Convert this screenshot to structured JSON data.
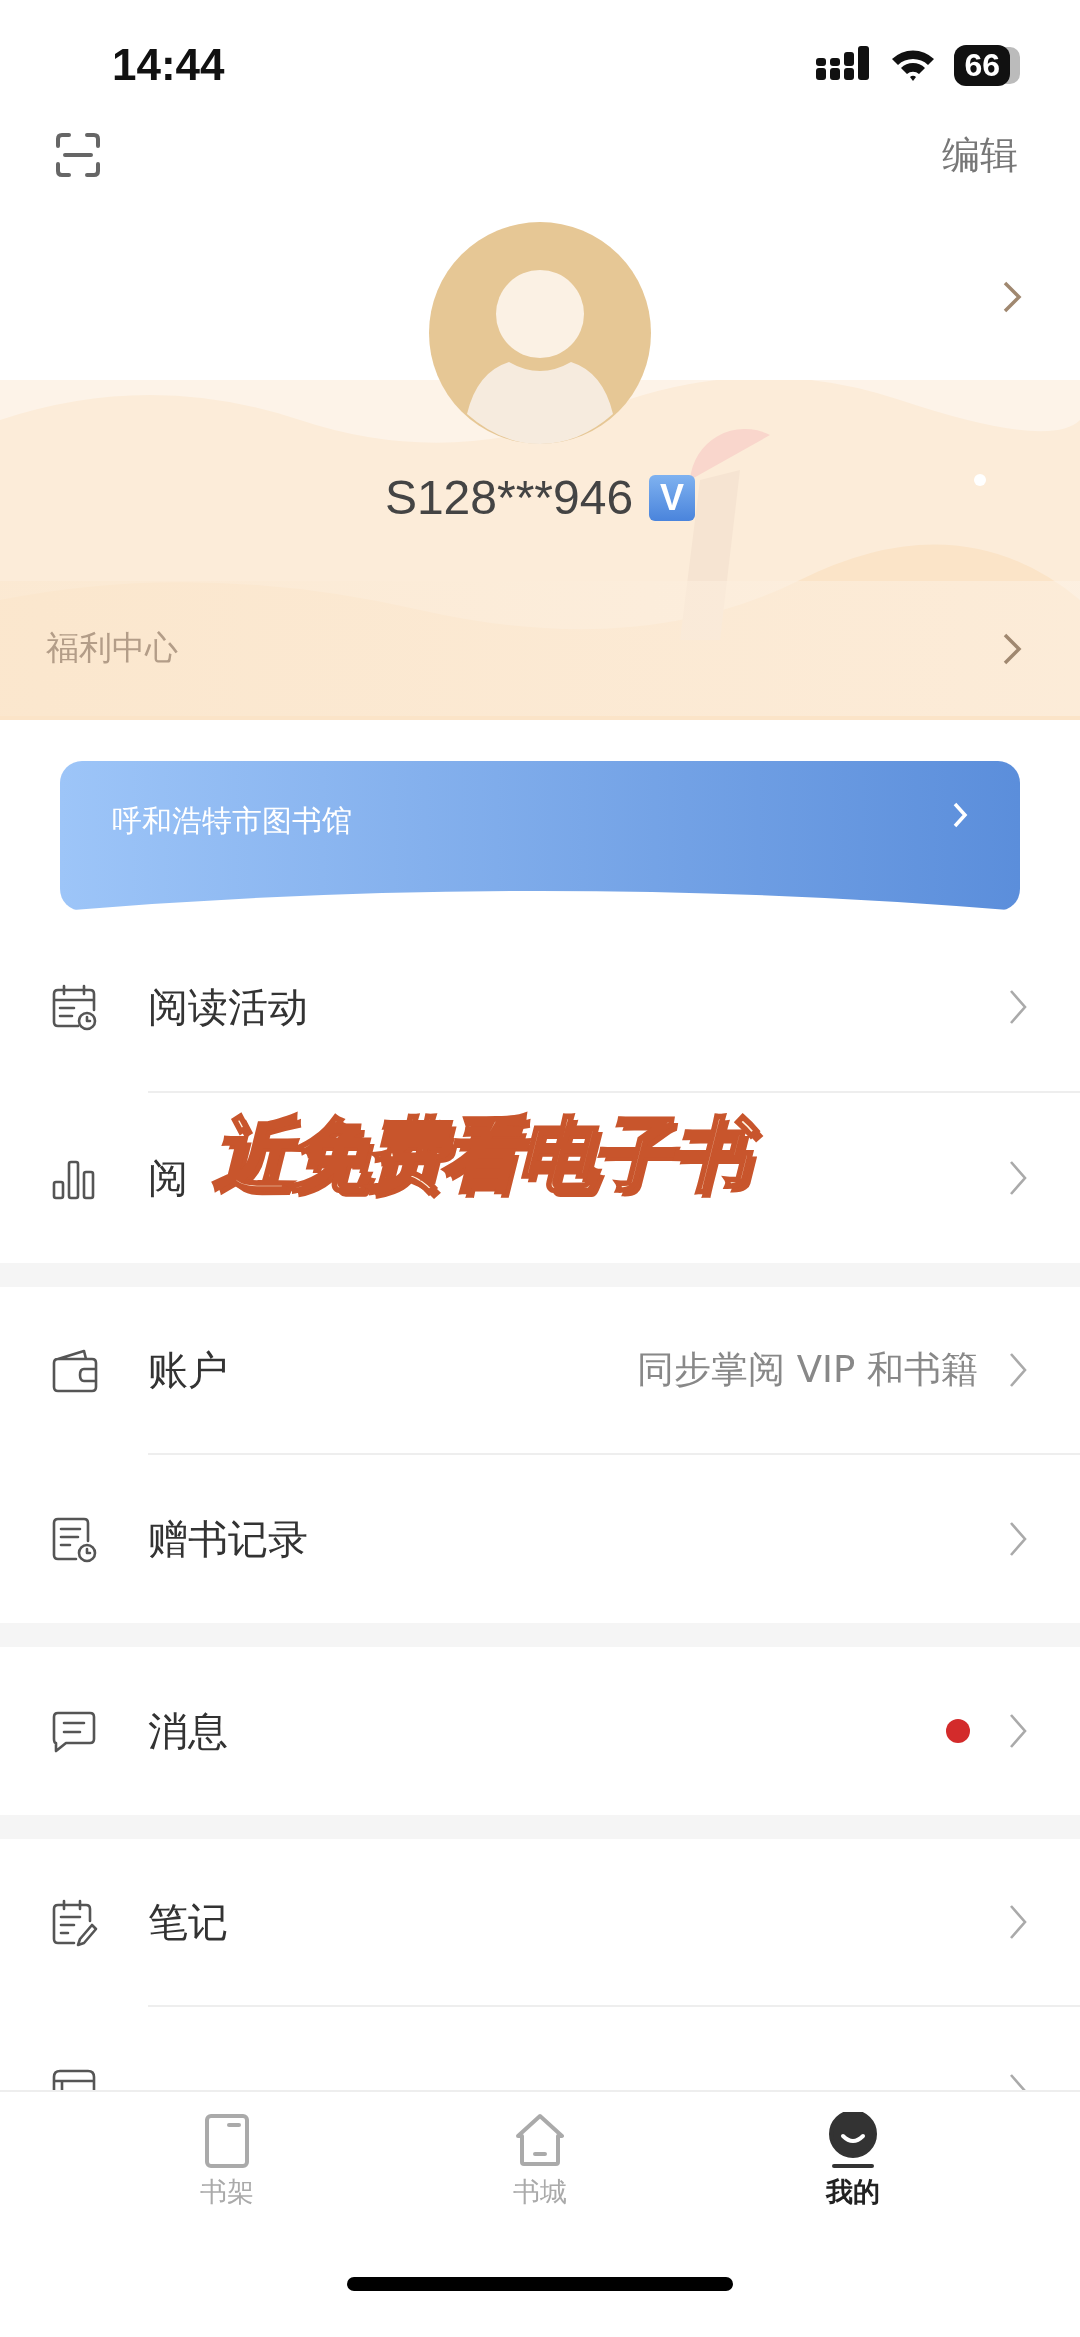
{
  "status_bar": {
    "time": "14:44",
    "battery": "66"
  },
  "top_bar": {
    "edit": "编辑"
  },
  "profile": {
    "username": "S128***946",
    "vip_badge": "V"
  },
  "welfare": {
    "label": "福利中心"
  },
  "library_card": {
    "label": "呼和浩特市图书馆"
  },
  "menu_groups": [
    {
      "items": [
        {
          "kind": "calendar",
          "label": "阅读活动"
        },
        {
          "kind": "chart",
          "label": "阅"
        }
      ]
    },
    {
      "items": [
        {
          "kind": "wallet",
          "label": "账户",
          "detail": "同步掌阅 VIP 和书籍"
        },
        {
          "kind": "record",
          "label": "赠书记录"
        }
      ]
    },
    {
      "items": [
        {
          "kind": "message",
          "label": "消息",
          "unread_dot": true
        }
      ]
    },
    {
      "items": [
        {
          "kind": "note",
          "label": "笔记"
        },
        {
          "kind": "history"
        }
      ]
    }
  ],
  "tabs": [
    {
      "kind": "shelf",
      "label": "书架",
      "selected": false
    },
    {
      "kind": "store",
      "label": "书城",
      "selected": false
    },
    {
      "kind": "me",
      "label": "我的",
      "selected": true
    }
  ],
  "overlay_caption": "近免费看电子书"
}
